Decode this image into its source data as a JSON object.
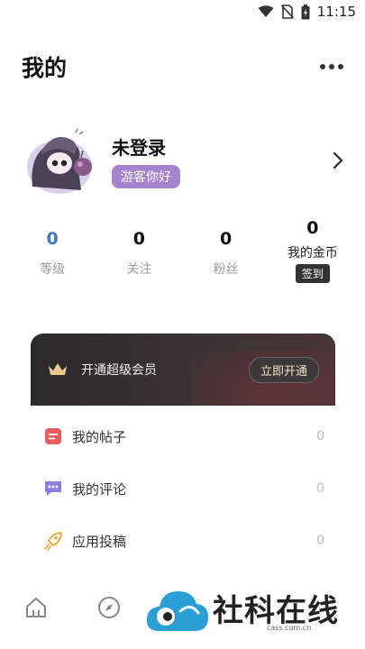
{
  "status_bar": {
    "time": "11:15"
  },
  "header": {
    "title": "我的"
  },
  "profile": {
    "name": "未登录",
    "badge": "游客你好"
  },
  "stats": [
    {
      "value": "0",
      "label": "等级"
    },
    {
      "value": "0",
      "label": "关注"
    },
    {
      "value": "0",
      "label": "粉丝"
    },
    {
      "value": "0",
      "label": "我的金币",
      "action": "签到"
    }
  ],
  "vip": {
    "label": "开通超级会员",
    "button": "立即开通"
  },
  "menu": [
    {
      "label": "我的帖子",
      "count": "0",
      "icon": "post-icon"
    },
    {
      "label": "我的评论",
      "count": "0",
      "icon": "comment-icon"
    },
    {
      "label": "应用投稿",
      "count": "0",
      "icon": "rocket-icon"
    }
  ],
  "tabs": [
    "home-icon",
    "compass-icon"
  ],
  "watermark": {
    "text": "社科在线",
    "sub": "cass.com.cn"
  },
  "colors": {
    "accent_blue": "#3e78c7",
    "badge_purple": "#a583ce",
    "vip_dark": "#2d2a2b",
    "watermark_blue": "#2a9fd6"
  }
}
